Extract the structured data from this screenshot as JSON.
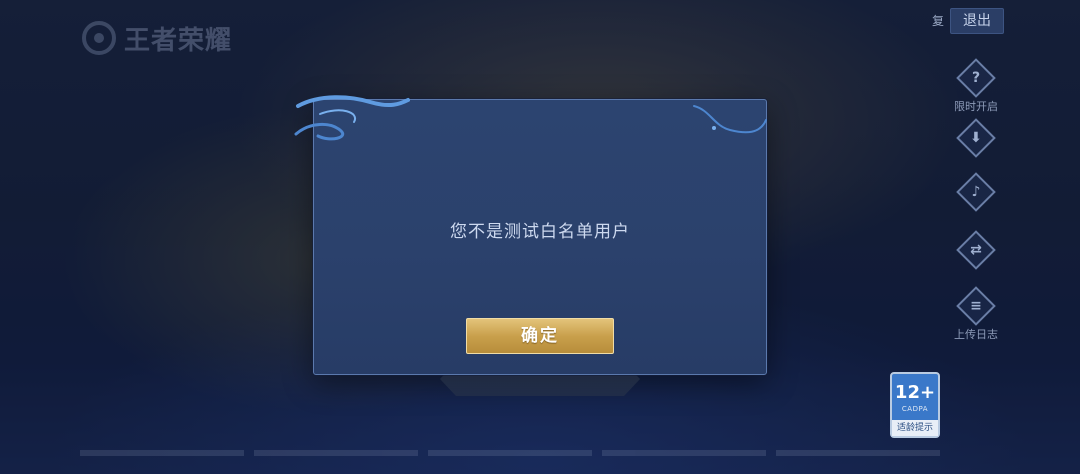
{
  "header": {
    "logo_text": "王者荣耀",
    "exit_prefix": "复",
    "exit_label": "退出"
  },
  "sidebar": {
    "items": [
      {
        "icon": "question-icon",
        "glyph": "?",
        "label": "限时开启"
      },
      {
        "icon": "download-icon",
        "glyph": "⬇",
        "label": ""
      },
      {
        "icon": "speaker-icon",
        "glyph": "🔈",
        "label": ""
      },
      {
        "icon": "switch-account-icon",
        "glyph": "⇄",
        "label": ""
      },
      {
        "icon": "clipboard-icon",
        "glyph": "≡",
        "label": "上传日志"
      }
    ]
  },
  "age_rating": {
    "number": "12+",
    "org": "CADPA",
    "text": "适龄提示"
  },
  "dialog": {
    "message": "您不是测试白名单用户",
    "confirm_label": "确定"
  },
  "colors": {
    "dialog_bg": "#2c4470",
    "button_gold": "#c9a04c",
    "age_badge": "#3a78c9"
  }
}
